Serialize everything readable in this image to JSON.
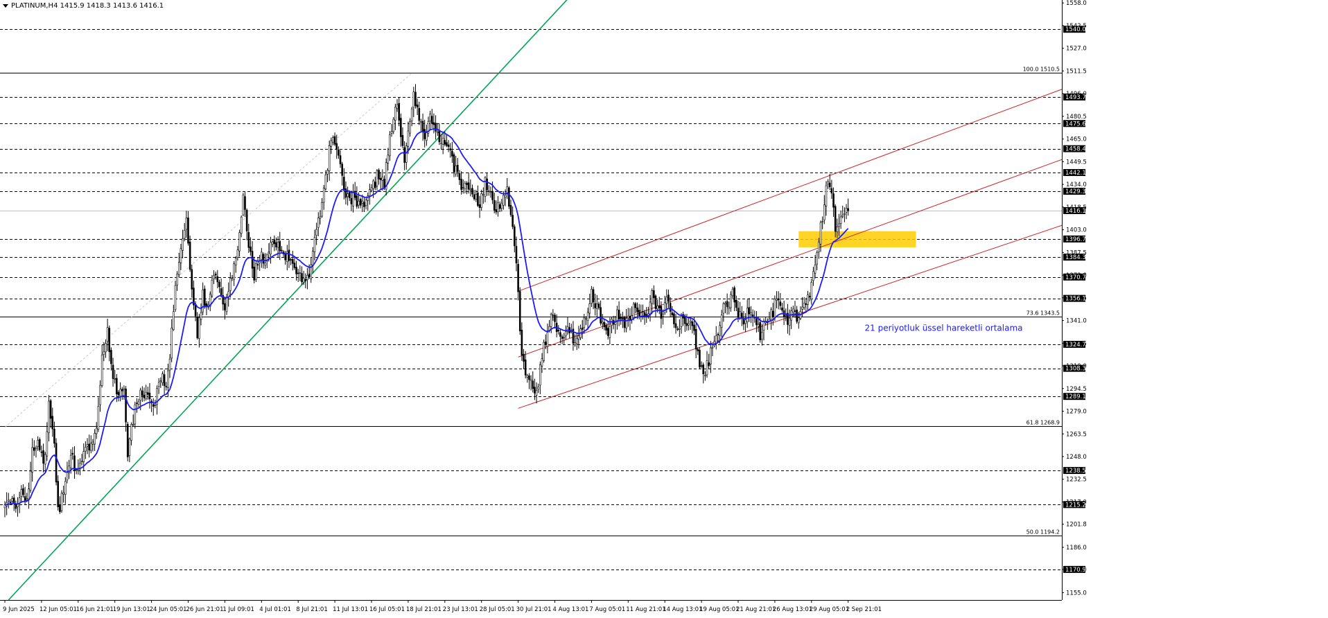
{
  "chart_data": {
    "type": "candlestick",
    "symbol_header": "PLATINUM,H4  1415.9 1418.3 1413.6 1416.1",
    "ylim": [
      1150.0,
      1560.0
    ],
    "y_ticks": [
      1155.0,
      1170.9,
      1186.0,
      1201.8,
      1217.0,
      1232.5,
      1248.0,
      1263.5,
      1279.0,
      1294.5,
      1310.0,
      1325.5,
      1341.0,
      1356.5,
      1372.0,
      1387.5,
      1403.0,
      1418.5,
      1434.0,
      1449.5,
      1465.0,
      1480.5,
      1496.0,
      1511.5,
      1527.0,
      1542.5,
      1558.0
    ],
    "x_ticks": [
      {
        "bar": 0,
        "label": "9 Jun 2025"
      },
      {
        "bar": 20,
        "label": "12 Jun 05:01"
      },
      {
        "bar": 40,
        "label": "16 Jun 21:01"
      },
      {
        "bar": 60,
        "label": "19 Jun 13:01"
      },
      {
        "bar": 80,
        "label": "24 Jun 05:01"
      },
      {
        "bar": 100,
        "label": "26 Jun 21:01"
      },
      {
        "bar": 120,
        "label": "1 Jul 09:01"
      },
      {
        "bar": 140,
        "label": "4 Jul 01:01"
      },
      {
        "bar": 160,
        "label": "8 Jul 21:01"
      },
      {
        "bar": 180,
        "label": "11 Jul 13:01"
      },
      {
        "bar": 200,
        "label": "16 Jul 05:01"
      },
      {
        "bar": 220,
        "label": "18 Jul 21:01"
      },
      {
        "bar": 240,
        "label": "23 Jul 13:01"
      },
      {
        "bar": 260,
        "label": "28 Jul 05:01"
      },
      {
        "bar": 280,
        "label": "30 Jul 21:01"
      },
      {
        "bar": 300,
        "label": "4 Aug 13:01"
      },
      {
        "bar": 320,
        "label": "7 Aug 05:01"
      },
      {
        "bar": 340,
        "label": "11 Aug 21:01"
      },
      {
        "bar": 360,
        "label": "14 Aug 13:01"
      },
      {
        "bar": 380,
        "label": "19 Aug 05:01"
      },
      {
        "bar": 400,
        "label": "21 Aug 21:01"
      },
      {
        "bar": 420,
        "label": "26 Aug 13:01"
      },
      {
        "bar": 440,
        "label": "29 Aug 05:01"
      },
      {
        "bar": 460,
        "label": "2 Sep 21:01"
      }
    ],
    "price_levels": [
      1540.0,
      1493.7,
      1475.6,
      1458.4,
      1442.1,
      1429.3,
      1396.7,
      1384.3,
      1370.7,
      1356.1,
      1324.7,
      1308.3,
      1289.1,
      1238.5,
      1215.2,
      1170.9
    ],
    "current_price": 1416.1,
    "fibonacci": [
      {
        "label": "100.0 1510.5",
        "price": 1510.5
      },
      {
        "label": "73.6 1343.5",
        "price": 1343.5
      },
      {
        "label": "61.8 1268.9",
        "price": 1268.9
      },
      {
        "label": "50.0 1194.2",
        "price": 1194.2
      }
    ],
    "anchors": [
      [
        0,
        1214
      ],
      [
        3,
        1220
      ],
      [
        6,
        1212
      ],
      [
        9,
        1226
      ],
      [
        12,
        1218
      ],
      [
        15,
        1250
      ],
      [
        18,
        1262
      ],
      [
        21,
        1240
      ],
      [
        24,
        1282
      ],
      [
        27,
        1256
      ],
      [
        29,
        1210
      ],
      [
        32,
        1224
      ],
      [
        36,
        1248
      ],
      [
        40,
        1238
      ],
      [
        44,
        1250
      ],
      [
        47,
        1256
      ],
      [
        50,
        1268
      ],
      [
        53,
        1315
      ],
      [
        56,
        1335
      ],
      [
        59,
        1302
      ],
      [
        62,
        1288
      ],
      [
        65,
        1296
      ],
      [
        67,
        1252
      ],
      [
        70,
        1274
      ],
      [
        74,
        1295
      ],
      [
        78,
        1290
      ],
      [
        82,
        1285
      ],
      [
        85,
        1302
      ],
      [
        88,
        1300
      ],
      [
        90,
        1318
      ],
      [
        93,
        1365
      ],
      [
        96,
        1392
      ],
      [
        99,
        1410
      ],
      [
        102,
        1365
      ],
      [
        105,
        1332
      ],
      [
        108,
        1358
      ],
      [
        111,
        1350
      ],
      [
        114,
        1372
      ],
      [
        117,
        1368
      ],
      [
        120,
        1350
      ],
      [
        123,
        1370
      ],
      [
        126,
        1380
      ],
      [
        130,
        1425
      ],
      [
        133,
        1392
      ],
      [
        136,
        1372
      ],
      [
        139,
        1384
      ],
      [
        142,
        1382
      ],
      [
        146,
        1398
      ],
      [
        150,
        1390
      ],
      [
        154,
        1385
      ],
      [
        158,
        1375
      ],
      [
        162,
        1370
      ],
      [
        166,
        1375
      ],
      [
        170,
        1400
      ],
      [
        174,
        1430
      ],
      [
        178,
        1465
      ],
      [
        182,
        1452
      ],
      [
        186,
        1425
      ],
      [
        190,
        1425
      ],
      [
        195,
        1420
      ],
      [
        200,
        1430
      ],
      [
        204,
        1442
      ],
      [
        207,
        1435
      ],
      [
        210,
        1465
      ],
      [
        213,
        1490
      ],
      [
        215,
        1480
      ],
      [
        218,
        1450
      ],
      [
        221,
        1475
      ],
      [
        223,
        1496
      ],
      [
        226,
        1480
      ],
      [
        229,
        1465
      ],
      [
        232,
        1478
      ],
      [
        235,
        1470
      ],
      [
        238,
        1462
      ],
      [
        241,
        1460
      ],
      [
        244,
        1450
      ],
      [
        247,
        1440
      ],
      [
        250,
        1432
      ],
      [
        253,
        1430
      ],
      [
        256,
        1428
      ],
      [
        259,
        1420
      ],
      [
        262,
        1436
      ],
      [
        265,
        1425
      ],
      [
        268,
        1415
      ],
      [
        271,
        1422
      ],
      [
        274,
        1428
      ],
      [
        276,
        1410
      ],
      [
        278,
        1395
      ],
      [
        280,
        1360
      ],
      [
        282,
        1315
      ],
      [
        284,
        1305
      ],
      [
        287,
        1300
      ],
      [
        290,
        1290
      ],
      [
        293,
        1315
      ],
      [
        296,
        1335
      ],
      [
        299,
        1345
      ],
      [
        302,
        1330
      ],
      [
        305,
        1330
      ],
      [
        308,
        1335
      ],
      [
        311,
        1325
      ],
      [
        314,
        1335
      ],
      [
        317,
        1345
      ],
      [
        320,
        1358
      ],
      [
        323,
        1350
      ],
      [
        326,
        1336
      ],
      [
        329,
        1330
      ],
      [
        332,
        1342
      ],
      [
        335,
        1346
      ],
      [
        338,
        1340
      ],
      [
        341,
        1345
      ],
      [
        344,
        1350
      ],
      [
        347,
        1342
      ],
      [
        350,
        1346
      ],
      [
        353,
        1358
      ],
      [
        356,
        1350
      ],
      [
        358,
        1342
      ],
      [
        361,
        1356
      ],
      [
        364,
        1345
      ],
      [
        367,
        1338
      ],
      [
        370,
        1344
      ],
      [
        373,
        1340
      ],
      [
        376,
        1332
      ],
      [
        379,
        1310
      ],
      [
        382,
        1305
      ],
      [
        385,
        1318
      ],
      [
        388,
        1330
      ],
      [
        391,
        1346
      ],
      [
        394,
        1352
      ],
      [
        397,
        1358
      ],
      [
        400,
        1345
      ],
      [
        403,
        1342
      ],
      [
        406,
        1350
      ],
      [
        409,
        1345
      ],
      [
        412,
        1332
      ],
      [
        415,
        1340
      ],
      [
        418,
        1344
      ],
      [
        421,
        1355
      ],
      [
        424,
        1345
      ],
      [
        427,
        1338
      ],
      [
        430,
        1346
      ],
      [
        433,
        1342
      ],
      [
        436,
        1355
      ],
      [
        439,
        1360
      ],
      [
        442,
        1380
      ],
      [
        445,
        1405
      ],
      [
        447,
        1420
      ],
      [
        448,
        1435
      ],
      [
        450,
        1432
      ],
      [
        452,
        1415
      ],
      [
        453,
        1398
      ],
      [
        455,
        1410
      ],
      [
        458,
        1418
      ],
      [
        460,
        1416
      ]
    ],
    "seed": 20250609,
    "ema": {
      "period": 21
    },
    "annotation": "21 periyotluk üssel hareketli ortalama",
    "colors": {
      "candle": "#000000",
      "ema": "#1a1aff",
      "trendline": "#00a651",
      "channel": "#cc2222",
      "highlight": "#ffcc00",
      "grid": "#000000",
      "fib": "#000000",
      "annotation": "#1a1aff"
    }
  }
}
